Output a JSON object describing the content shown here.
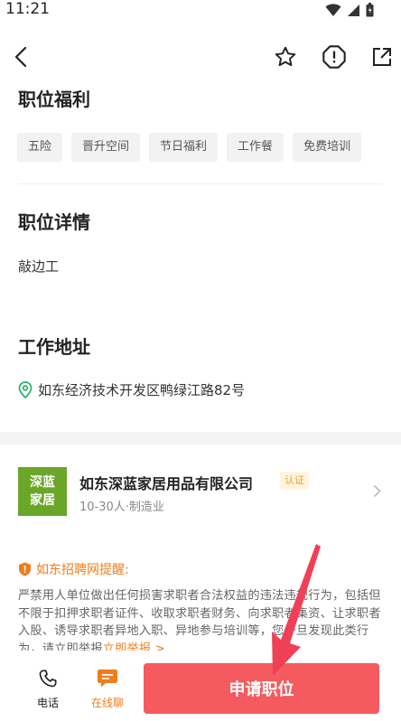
{
  "status_bar": {
    "time": "11:21",
    "icons": [
      "wifi-icon",
      "signal-icon",
      "battery-icon"
    ]
  },
  "nav": {
    "back_icon": "chevron-left-icon",
    "favorite_icon": "star-icon",
    "report_icon": "warning-icon",
    "share_icon": "share-icon"
  },
  "benefits": {
    "title": "职位福利",
    "tags": [
      "五险",
      "晋升空间",
      "节日福利",
      "工作餐",
      "免费培训"
    ]
  },
  "details": {
    "title": "职位详情",
    "text": "敲边工"
  },
  "address": {
    "title": "工作地址",
    "text": "如东经济技术开发区鸭绿江路82号",
    "icon": "location-pin-icon"
  },
  "company": {
    "logo_line1": "深蓝",
    "logo_line2": "家居",
    "name": "如东深蓝家居用品有限公司",
    "badge": "认证",
    "meta": "10-30人·制造业"
  },
  "warning": {
    "title": "如东招聘网提醒:",
    "text": "严禁用人单位做出任何损害求职者合法权益的违法违规行为，包括但不限于扣押求职者证件、收取求职者财务、向求职者集资、让求职者入股、诱导求职者异地入职、异地参与培训等，您一旦发现此类行为，请立即举报",
    "link": "立即举报 >"
  },
  "bottom": {
    "phone_label": "电话",
    "chat_label": "在线聊",
    "apply_label": "申请职位"
  },
  "colors": {
    "accent_orange": "#f07d1a",
    "apply_red": "#f45a5e",
    "logo_green": "#6aa628"
  }
}
